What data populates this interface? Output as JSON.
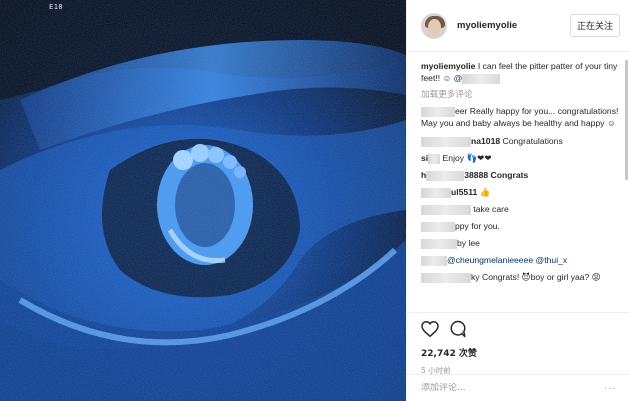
{
  "photo": {
    "scan_label": "E10"
  },
  "header": {
    "username": "myoliemyolie",
    "follow_label": "正在关注"
  },
  "caption": {
    "user": "myoliemyolie",
    "text": "I can feel the pitter patter of your tiny feet!! ",
    "emoji": "☺",
    "mention": "@"
  },
  "load_more": "加载更多评论",
  "comments": [
    {
      "user": "",
      "text": "eer Really happy for you... congratulations! May you and baby always be healthy and happy ☺"
    },
    {
      "user": "na1018",
      "text": " Congratulations"
    },
    {
      "user": "si",
      "text": " Enjoy 👣❤❤"
    },
    {
      "user": "h",
      "text": "38888 Congrats"
    },
    {
      "user": "ul5511",
      "text": " 👍"
    },
    {
      "user": "",
      "text": " take care"
    },
    {
      "user": "",
      "text": "ppy for you."
    },
    {
      "user": "",
      "text": "by lee"
    },
    {
      "user": "",
      "text": "@cheungmelanieeeee @thui_x"
    },
    {
      "user": "",
      "text": "ky Congrats! 😈boy or girl yaa? 😡"
    }
  ],
  "actions": {
    "like_icon": "heart-icon",
    "comment_icon": "comment-icon",
    "likes": "22,742 次赞",
    "time": "5 小时前"
  },
  "add_comment": {
    "placeholder": "添加评论...",
    "options": "···"
  }
}
